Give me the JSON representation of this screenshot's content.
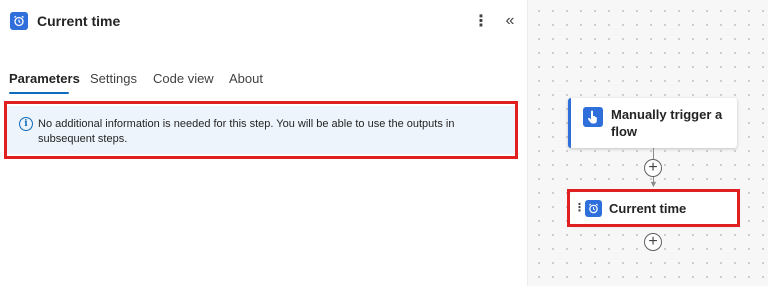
{
  "header": {
    "title": "Current time",
    "title_icon": "alarm-clock-icon",
    "more_icon": "⋮",
    "collapse_icon": "«"
  },
  "tabs": [
    {
      "label": "Parameters",
      "active": true
    },
    {
      "label": "Settings",
      "active": false
    },
    {
      "label": "Code view",
      "active": false
    },
    {
      "label": "About",
      "active": false
    }
  ],
  "info": {
    "icon": "i",
    "text": "No additional information is needed for this step. You will be able to use the outputs in subsequent steps."
  },
  "flow": {
    "trigger": {
      "label": "Manually trigger a flow",
      "icon": "hand-pointer-icon"
    },
    "action": {
      "label": "Current time",
      "icon": "alarm-clock-icon",
      "drag_handle": "⋮"
    },
    "add_glyph": "+"
  },
  "colors": {
    "accent": "#0f6cbd",
    "icon_bg": "#2f6fdc",
    "highlight": "#e02020",
    "info_bg": "#eef4fc"
  }
}
